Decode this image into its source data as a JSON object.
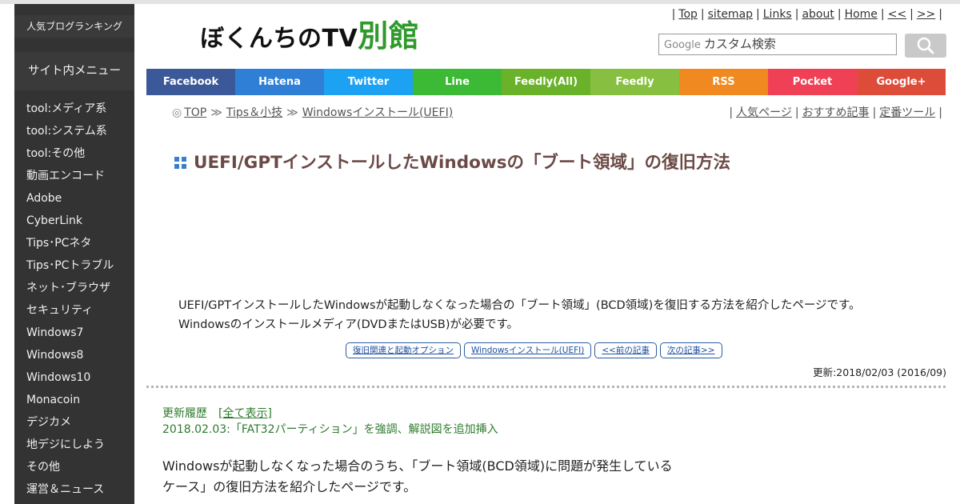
{
  "sidebar": {
    "ranking_label": "人気ブログランキング",
    "menu_title": "サイト内メニュー",
    "items": [
      {
        "label": "tool:メディア系"
      },
      {
        "label": "tool:システム系"
      },
      {
        "label": "tool:その他"
      },
      {
        "label": "動画エンコード"
      },
      {
        "label": "Adobe"
      },
      {
        "label": "CyberLink"
      },
      {
        "label": "Tips･PCネタ"
      },
      {
        "label": "Tips･PCトラブル"
      },
      {
        "label": "ネット･ブラウザ"
      },
      {
        "label": "セキュリティ"
      },
      {
        "label": "Windows7"
      },
      {
        "label": "Windows8"
      },
      {
        "label": "Windows10"
      },
      {
        "label": "Monacoin"
      },
      {
        "label": "デジカメ"
      },
      {
        "label": "地デジにしよう"
      },
      {
        "label": "その他"
      },
      {
        "label": "運営＆ニュース"
      }
    ]
  },
  "header": {
    "logo_text": "ぼくんちのTV",
    "logo_accent": "別館",
    "top_links": [
      "Top",
      "sitemap",
      "Links",
      "about",
      "Home",
      "<<",
      ">>"
    ],
    "search_brand": "Google",
    "search_placeholder": "カスタム検索"
  },
  "share_bar": [
    {
      "label": "Facebook",
      "color": "#3b5998"
    },
    {
      "label": "Hatena",
      "color": "#2f7fd6"
    },
    {
      "label": "Twitter",
      "color": "#1da1f2"
    },
    {
      "label": "Line",
      "color": "#3cb935"
    },
    {
      "label": "Feedly(All)",
      "color": "#6ab22a"
    },
    {
      "label": "Feedly",
      "color": "#87c040"
    },
    {
      "label": "RSS",
      "color": "#f08a20"
    },
    {
      "label": "Pocket",
      "color": "#ef4056"
    },
    {
      "label": "Google+",
      "color": "#dd4b39"
    }
  ],
  "breadcrumb": {
    "marker": "◎",
    "items": [
      "TOP",
      "Tips＆小技",
      "Windowsインストール(UEFI)"
    ],
    "separator": "≫"
  },
  "sub_links": [
    "人気ページ",
    "おすすめ記事",
    "定番ツール"
  ],
  "article": {
    "title": "UEFI/GPTインストールしたWindowsの「ブート領域」の復旧方法",
    "intro": "UEFI/GPTインストールしたWindowsが起動しなくなった場合の「ブート領域」(BCD領域)を復旧する方法を紹介したページです。Windowsのインストールメディア(DVDまたはUSB)が必要です。",
    "nav_buttons": [
      "復旧関連と起動オプション",
      "Windowsインストール(UEFI)",
      "<<前の記事",
      "次の記事>>"
    ],
    "updated": "更新:2018/02/03 (2016/09)",
    "history_label": "更新履歴　[",
    "history_link": "全て表示",
    "history_close": "]",
    "history_entry": "2018.02.03:「FAT32パーティション」を強調、解説図を追加挿入",
    "body": "Windowsが起動しなくなった場合のうち、「ブート領域(BCD領域)に問題が発生しているケース」の復旧方法を紹介したページです。"
  }
}
